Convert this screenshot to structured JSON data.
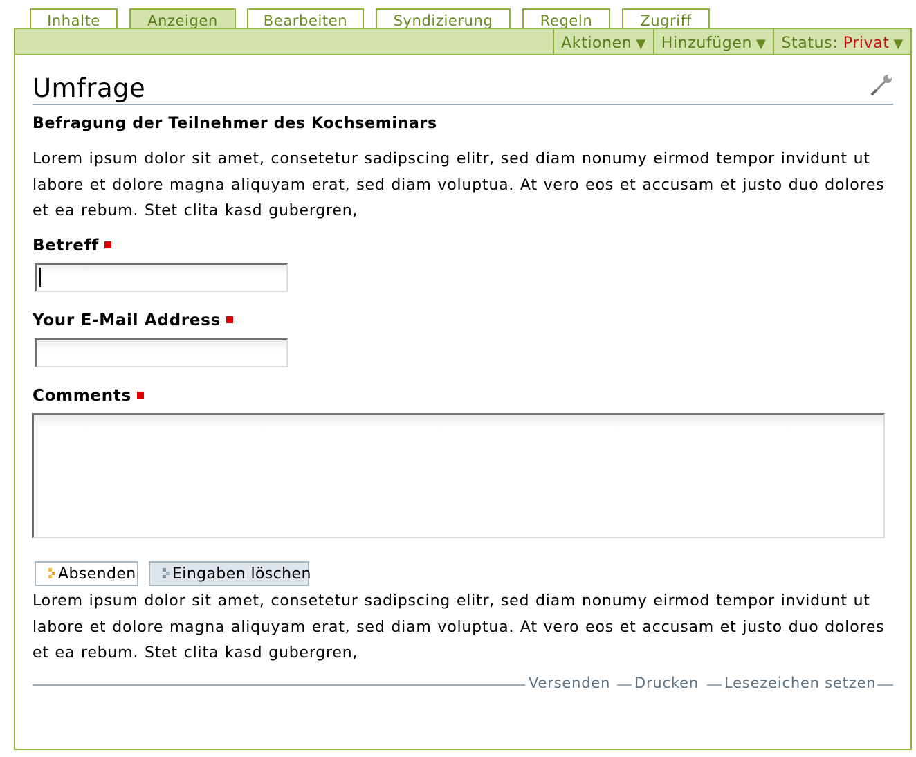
{
  "tabs": [
    {
      "label": "Inhalte",
      "active": false
    },
    {
      "label": "Anzeigen",
      "active": true
    },
    {
      "label": "Bearbeiten",
      "active": false
    },
    {
      "label": "Syndizierung",
      "active": false
    },
    {
      "label": "Regeln",
      "active": false
    },
    {
      "label": "Zugriff",
      "active": false
    }
  ],
  "actionbar": {
    "actions_label": "Aktionen",
    "add_label": "Hinzufügen",
    "status_label": "Status:",
    "status_value": "Privat",
    "arrow": "▼"
  },
  "page": {
    "title": "Umfrage",
    "subtitle": "Befragung der Teilnehmer des Kochseminars",
    "intro": "Lorem ipsum dolor sit amet, consetetur sadipscing elitr, sed diam nonumy eirmod tempor invidunt ut labore et dolore magna aliquyam erat, sed diam voluptua. At vero eos et accusam et justo duo dolores et ea rebum. Stet clita kasd gubergren,",
    "outro": "Lorem ipsum dolor sit amet, consetetur sadipscing elitr, sed diam nonumy eirmod tempor invidunt ut labore et dolore magna aliquyam erat, sed diam voluptua. At vero eos et accusam et justo duo dolores et ea rebum. Stet clita kasd gubergren,"
  },
  "form": {
    "subject_label": "Betreff",
    "subject_value": "",
    "email_label": "Your E-Mail Address",
    "email_value": "",
    "comments_label": "Comments",
    "comments_value": "",
    "submit_label": "Absenden",
    "reset_label": "Eingaben löschen"
  },
  "footer": {
    "send_label": "Versenden",
    "print_label": "Drucken",
    "bookmark_label": "Lesezeichen setzen"
  },
  "colors": {
    "accent_green": "#8fb33a",
    "bar_green": "#d4e3ad",
    "required_red": "#dd0000",
    "status_red": "#cc1111",
    "link_gray": "#5e7384"
  },
  "icons": {
    "edit": "wrench-icon",
    "required": "required-marker-icon",
    "submit": "submit-icon",
    "reset": "reset-icon"
  }
}
